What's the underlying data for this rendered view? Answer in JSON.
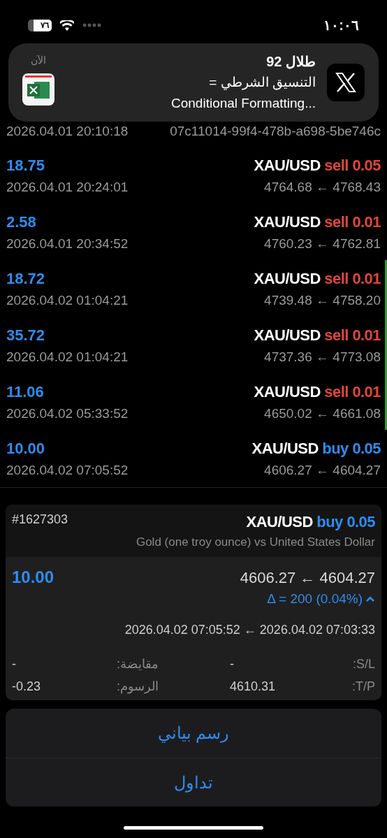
{
  "status_bar": {
    "time": "١٠:٠٦",
    "battery": "٧٦"
  },
  "notification": {
    "title": "طلال 92",
    "time": "الآن",
    "lines": [
      "التنسيق الشرطي =",
      "Conditional Formatting..."
    ]
  },
  "partial_row": {
    "date": "2026.04.01 20:10:18",
    "id": "07c11014-99f4-478b-a698-5be746c"
  },
  "trades": [
    {
      "profit": "18.75",
      "date": "2026.04.01 20:24:01",
      "symbol": "XAU/USD",
      "type": "sell",
      "volume": "0.05",
      "prices": "4764.68 ← 4768.43"
    },
    {
      "profit": "2.58",
      "date": "2026.04.01 20:34:52",
      "symbol": "XAU/USD",
      "type": "sell",
      "volume": "0.01",
      "prices": "4760.23 ← 4762.81"
    },
    {
      "profit": "18.72",
      "date": "2026.04.02 01:04:21",
      "symbol": "XAU/USD",
      "type": "sell",
      "volume": "0.01",
      "prices": "4739.48 ← 4758.20"
    },
    {
      "profit": "35.72",
      "date": "2026.04.02 01:04:21",
      "symbol": "XAU/USD",
      "type": "sell",
      "volume": "0.01",
      "prices": "4737.36 ← 4773.08"
    },
    {
      "profit": "11.06",
      "date": "2026.04.02 05:33:52",
      "symbol": "XAU/USD",
      "type": "sell",
      "volume": "0.01",
      "prices": "4650.02 ← 4661.08"
    },
    {
      "profit": "10.00",
      "date": "2026.04.02 07:05:52",
      "symbol": "XAU/USD",
      "type": "buy",
      "volume": "0.05",
      "prices": "4606.27 ← 4604.27"
    }
  ],
  "detail": {
    "ticket": "#1627303",
    "symbol": "XAU/USD",
    "type": "buy",
    "volume": "0.05",
    "description": "Gold (one troy ounce) vs United States Dollar",
    "profit": "10.00",
    "prices": "4606.27 ← 4604.27",
    "delta": "Δ = 200 (0.04%)",
    "expanded": true,
    "times": "2026.04.02 07:05:52 ← 2026.04.02 07:03:33",
    "fields": [
      {
        "value": "-",
        "label": "مقايضة:",
        "value2": "-",
        "label2": ":S/L"
      },
      {
        "value": "-0.23",
        "label": "الرسوم:",
        "value2": "4610.31",
        "label2": ":T/P"
      }
    ]
  },
  "actions": [
    "رسم بياني",
    "تداول"
  ]
}
